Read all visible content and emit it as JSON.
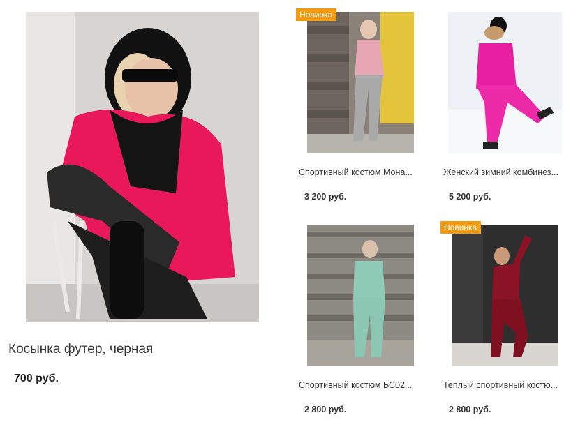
{
  "featured": {
    "name": "Косынка футер, черная",
    "price": "700 руб.",
    "image_icon": "woman-hood-sunglasses-photo"
  },
  "products": [
    {
      "name": "Спортивный костюм Мона...",
      "price": "3 200 руб.",
      "badge": "Новинка",
      "image_icon": "grey-tracksuit-photo"
    },
    {
      "name": "Женский зимний комбинез...",
      "price": "5 200 руб.",
      "badge": "",
      "image_icon": "pink-ski-suit-photo"
    },
    {
      "name": "Спортивный костюм БС02...",
      "price": "2 800 руб.",
      "badge": "",
      "image_icon": "mint-tracksuit-photo"
    },
    {
      "name": "Теплый спортивный костю...",
      "price": "2 800 руб.",
      "badge": "Новинка",
      "image_icon": "burgundy-suit-photo"
    }
  ],
  "colors": {
    "badge": "#f39a0e",
    "accent_pink": "#e8185a"
  }
}
